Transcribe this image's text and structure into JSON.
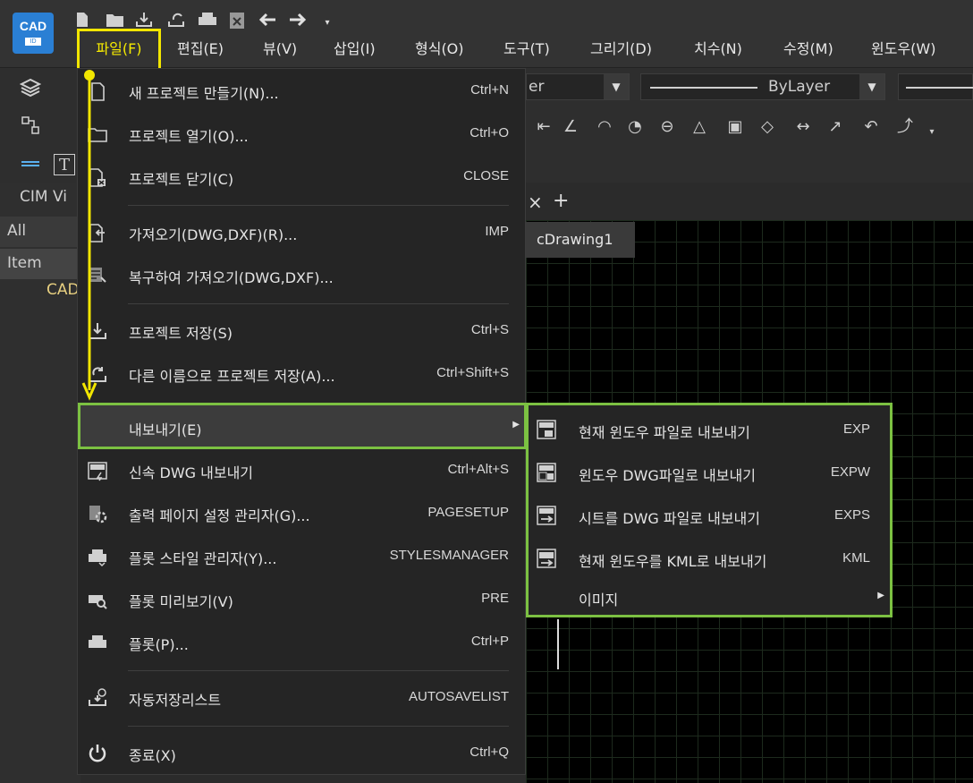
{
  "app": {
    "logo_text": "CAD",
    "logo_sub": "ID"
  },
  "menubar": [
    {
      "label": "파일(F)"
    },
    {
      "label": "편집(E)"
    },
    {
      "label": "뷰(V)"
    },
    {
      "label": "삽입(I)"
    },
    {
      "label": "형식(O)"
    },
    {
      "label": "도구(T)"
    },
    {
      "label": "그리기(D)"
    },
    {
      "label": "치수(N)"
    },
    {
      "label": "수정(M)"
    },
    {
      "label": "윈도우(W)"
    }
  ],
  "toolbar": {
    "layer_combo_text": "er",
    "linetype_combo_text": "ByLayer"
  },
  "left_panel": {
    "title": "CIM Vi",
    "filter": "All",
    "column_header": "Item",
    "row1": "CAD"
  },
  "document_tab": {
    "label": "cDrawing1",
    "close": "×",
    "add": "+"
  },
  "file_menu": {
    "items": [
      {
        "icon": "new-project-icon",
        "label": "새 프로젝트 만들기(N)...",
        "shortcut": "Ctrl+N"
      },
      {
        "icon": "open-folder-icon",
        "label": "프로젝트 열기(O)...",
        "shortcut": "Ctrl+O"
      },
      {
        "icon": "close-project-icon",
        "label": "프로젝트 닫기(C)",
        "shortcut": "CLOSE"
      },
      {
        "icon": "import-icon",
        "label": "가져오기(DWG,DXF)(R)...",
        "shortcut": "IMP"
      },
      {
        "icon": "recover-import-icon",
        "label": "복구하여 가져오기(DWG,DXF)...",
        "shortcut": ""
      },
      {
        "icon": "save-icon",
        "label": "프로젝트 저장(S)",
        "shortcut": "Ctrl+S"
      },
      {
        "icon": "save-as-icon",
        "label": "다른 이름으로 프로젝트 저장(A)...",
        "shortcut": "Ctrl+Shift+S"
      },
      {
        "icon": "",
        "label": "내보내기(E)",
        "shortcut": ""
      },
      {
        "icon": "dwg-quick-export-icon",
        "label": "신속 DWG 내보내기",
        "shortcut": "Ctrl+Alt+S"
      },
      {
        "icon": "page-setup-icon",
        "label": "출력 페이지 설정 관리자(G)...",
        "shortcut": "PAGESETUP"
      },
      {
        "icon": "plot-style-icon",
        "label": "플롯 스타일 관리자(Y)...",
        "shortcut": "STYLESMANAGER"
      },
      {
        "icon": "plot-preview-icon",
        "label": "플롯 미리보기(V)",
        "shortcut": "PRE"
      },
      {
        "icon": "printer-icon",
        "label": "플롯(P)...",
        "shortcut": "Ctrl+P"
      },
      {
        "icon": "autosave-list-icon",
        "label": "자동저장리스트",
        "shortcut": "AUTOSAVELIST"
      },
      {
        "icon": "power-icon",
        "label": "종료(X)",
        "shortcut": "Ctrl+Q"
      }
    ]
  },
  "export_submenu": {
    "items": [
      {
        "icon": "dwg-export-icon",
        "label": "현재 윈도우 파일로 내보내기",
        "shortcut": "EXP"
      },
      {
        "icon": "dwg-window-export-icon",
        "label": "윈도우 DWG파일로 내보내기",
        "shortcut": "EXPW"
      },
      {
        "icon": "dwg-sheet-export-icon",
        "label": "시트를 DWG 파일로 내보내기",
        "shortcut": "EXPS"
      },
      {
        "icon": "kml-export-icon",
        "label": "현재 윈도우를 KML로 내보내기",
        "shortcut": "KML"
      },
      {
        "icon": "",
        "label": "이미지",
        "shortcut": ""
      }
    ]
  },
  "colors": {
    "highlight_yellow": "#f2e600",
    "highlight_green": "#7cc142"
  }
}
